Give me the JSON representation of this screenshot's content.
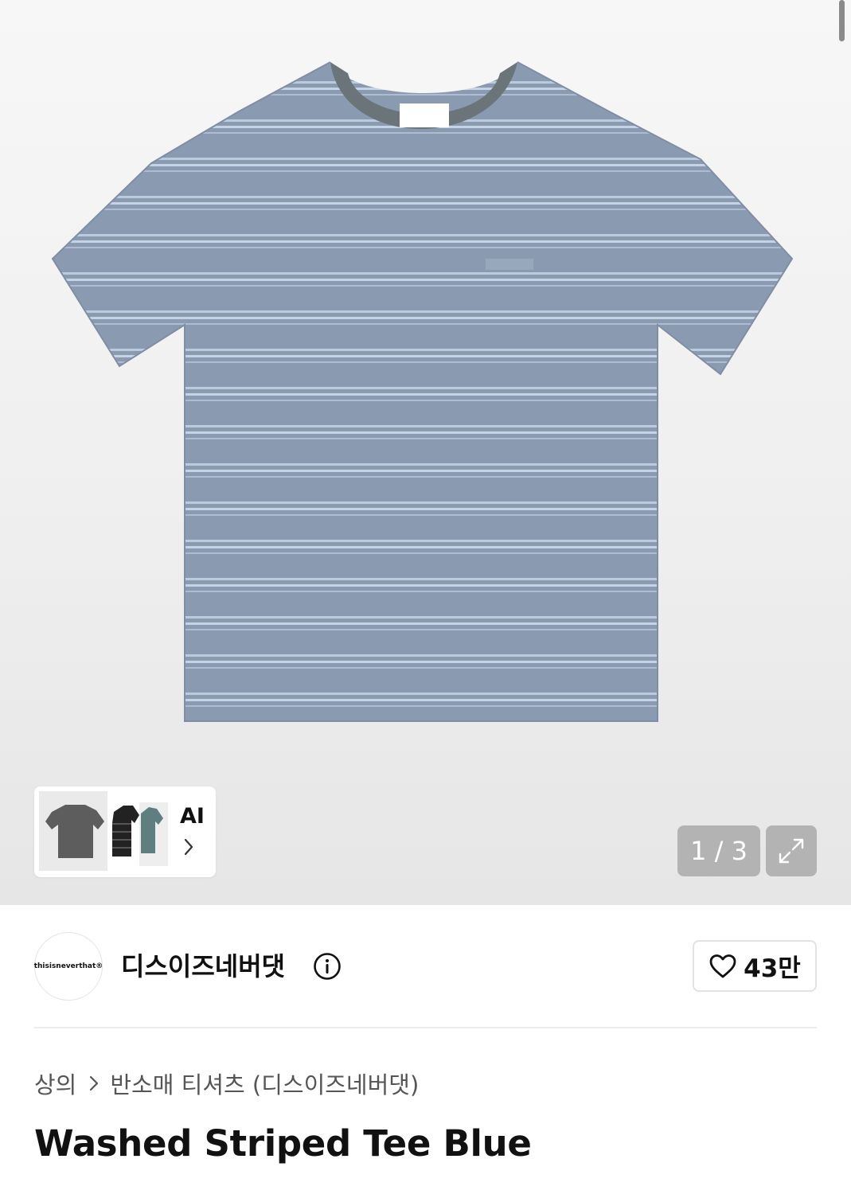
{
  "gallery": {
    "ai_label": "AI",
    "counter": "1 / 3"
  },
  "brand": {
    "logo_text": "thisisneverthat®",
    "name": "디스이즈네버댓",
    "likes": "43만"
  },
  "breadcrumb": {
    "category": "상의",
    "subcategory": "반소매 티셔츠 (디스이즈네버댓)"
  },
  "product": {
    "title": "Washed Striped Tee Blue"
  },
  "colors": {
    "shirt": "#8a9ab1",
    "stripe": "#b9c8dc",
    "collar": "#6b7479"
  }
}
